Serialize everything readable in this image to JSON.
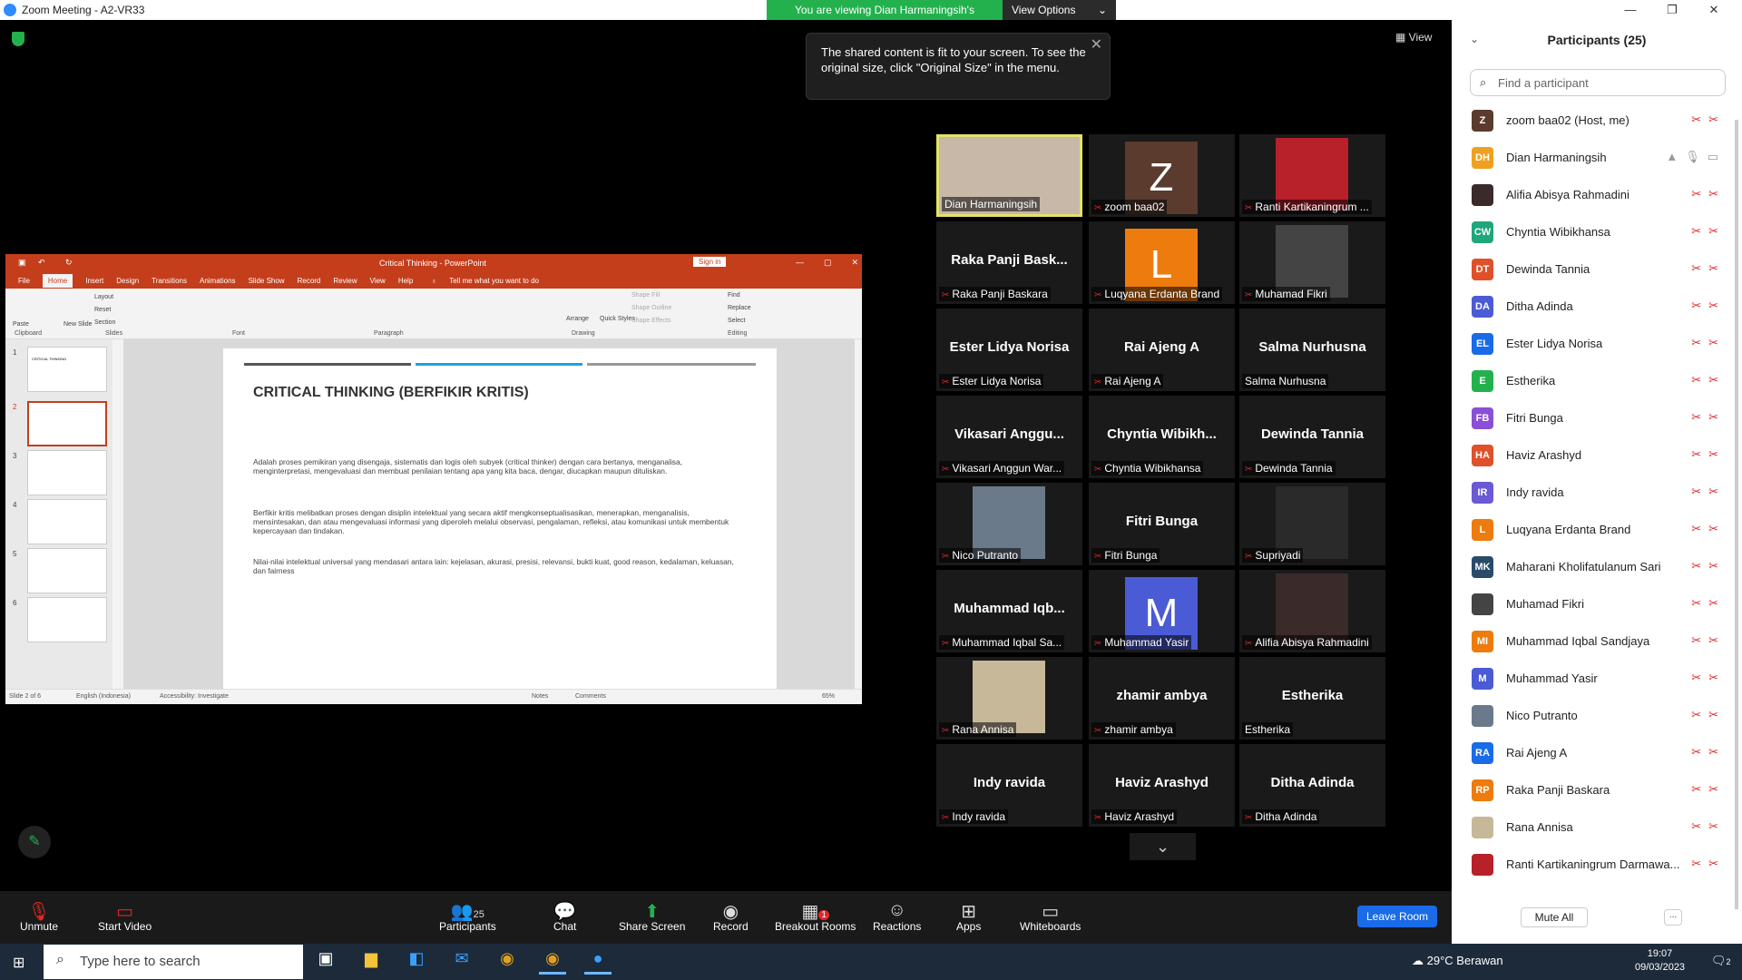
{
  "window": {
    "title": "Zoom Meeting - A2-VR33",
    "banner": "You are viewing Dian Harmaningsih's screen",
    "view_options": "View Options"
  },
  "stage": {
    "view_label": "View",
    "tooltip": "The shared content is fit to your screen. To see the original size, click \"Original Size\" in the menu."
  },
  "ppt": {
    "doc_title": "Critical Thinking  -  PowerPoint",
    "sign_in": "Sign in",
    "tabs": [
      "File",
      "Home",
      "Insert",
      "Design",
      "Transitions",
      "Animations",
      "Slide Show",
      "Record",
      "Review",
      "View",
      "Help"
    ],
    "tell_me": "Tell me what you want to do",
    "groups": {
      "clipboard": "Clipboard",
      "slides": "Slides",
      "font": "Font",
      "paragraph": "Paragraph",
      "drawing": "Drawing",
      "editing": "Editing"
    },
    "ribbon": {
      "paste": "Paste",
      "new_slide": "New Slide",
      "layout": "Layout",
      "reset": "Reset",
      "section": "Section",
      "arrange": "Arrange",
      "quick_styles": "Quick Styles",
      "shape_fill": "Shape Fill",
      "shape_outline": "Shape Outline",
      "shape_effects": "Shape Effects",
      "find": "Find",
      "replace": "Replace",
      "select": "Select"
    },
    "slide_title": "CRITICAL THINKING (BERFIKIR KRITIS)",
    "para1": "Adalah proses pemikiran yang disengaja, sistematis dan logis oleh subyek (critical thinker) dengan cara bertanya, menganalisa, menginterpretasi, mengevaluasi dan membuat penilaian tentang apa yang kita baca, dengar, diucapkan maupun dituliskan.",
    "para2": "Berfikir kritis melibatkan proses dengan disiplin intelektual yang secara aktif mengkonseptualisasikan, menerapkan, menganalisis, mensintesakan, dan atau mengevaluasi informasi yang diperoleh melalui observasi, pengalaman, refleksi, atau komunikasi untuk membentuk kepercayaan dan tindakan.",
    "para3": "Nilai-nilai intelektual universal yang mendasari antara lain: kejelasan, akurasi, presisi, relevansi, bukti kuat, good reason, kedalaman, keluasan, dan fairness",
    "slide_nums": [
      "1",
      "2",
      "3",
      "4",
      "5",
      "6"
    ],
    "thumb1_text": "CRITICAL THINKING",
    "status": {
      "slide": "Slide 2 of 6",
      "lang": "English (Indonesia)",
      "access": "Accessibility: Investigate",
      "notes": "Notes",
      "comments": "Comments",
      "zoom": "65%"
    }
  },
  "tiles": [
    {
      "big": "",
      "label": "Dian Harmaningsih",
      "kind": "photo",
      "color": "#c8b8a8",
      "mic": false
    },
    {
      "big": "",
      "label": "zoom baa02",
      "kind": "avatar",
      "letter": "Z",
      "color": "#5a3b2e",
      "mic": true
    },
    {
      "big": "",
      "label": "Ranti Kartikaningrum ...",
      "kind": "photo",
      "color": "#b8202a",
      "mic": true
    },
    {
      "big": "Raka Panji Bask...",
      "label": "Raka Panji Baskara",
      "kind": "name",
      "mic": true
    },
    {
      "big": "",
      "label": "Luqyana Erdanta Brand",
      "kind": "avatar",
      "letter": "L",
      "color": "#ee7b0e",
      "mic": true
    },
    {
      "big": "",
      "label": "Muhamad Fikri",
      "kind": "photo",
      "color": "#444444",
      "mic": true
    },
    {
      "big": "Ester Lidya Norisa",
      "label": "Ester Lidya Norisa",
      "kind": "name",
      "mic": true
    },
    {
      "big": "Rai Ajeng A",
      "label": "Rai Ajeng A",
      "kind": "name",
      "mic": true
    },
    {
      "big": "Salma Nurhusna",
      "label": "Salma Nurhusna",
      "kind": "name",
      "mic": false
    },
    {
      "big": "Vikasari Anggu...",
      "label": "Vikasari Anggun War...",
      "kind": "name",
      "mic": true
    },
    {
      "big": "Chyntia Wibikh...",
      "label": "Chyntia Wibikhansa",
      "kind": "name",
      "mic": true
    },
    {
      "big": "Dewinda Tannia",
      "label": "Dewinda Tannia",
      "kind": "name",
      "mic": true
    },
    {
      "big": "",
      "label": "Nico Putranto",
      "kind": "photo",
      "color": "#6a7a8a",
      "mic": true
    },
    {
      "big": "Fitri Bunga",
      "label": "Fitri Bunga",
      "kind": "name",
      "mic": true
    },
    {
      "big": "",
      "label": "Supriyadi",
      "kind": "photo",
      "color": "#2a2a2a",
      "mic": true
    },
    {
      "big": "Muhammad Iqb...",
      "label": "Muhammad Iqbal Sa...",
      "kind": "name",
      "mic": true
    },
    {
      "big": "",
      "label": "Muhammad Yasir",
      "kind": "avatar",
      "letter": "M",
      "color": "#4b5bd6",
      "mic": true
    },
    {
      "big": "",
      "label": "Alifia Abisya Rahmadini",
      "kind": "photo",
      "color": "#3a2a2a",
      "mic": true
    },
    {
      "big": "",
      "label": "Rana Annisa",
      "kind": "photo",
      "color": "#c8b89a",
      "mic": true
    },
    {
      "big": "zhamir ambya",
      "label": "zhamir ambya",
      "kind": "name",
      "mic": true
    },
    {
      "big": "Estherika",
      "label": "Estherika",
      "kind": "name",
      "mic": false
    },
    {
      "big": "Indy ravida",
      "label": "Indy ravida",
      "kind": "name",
      "mic": true
    },
    {
      "big": "Haviz Arashyd",
      "label": "Haviz Arashyd",
      "kind": "name",
      "mic": true
    },
    {
      "big": "Ditha Adinda",
      "label": "Ditha Adinda",
      "kind": "name",
      "mic": true
    }
  ],
  "panel": {
    "title": "Participants (25)",
    "search_placeholder": "Find a participant",
    "participants": [
      {
        "initials": "Z",
        "name": "zoom baa02 (Host, me)",
        "color": "#5a3b2e"
      },
      {
        "initials": "DH",
        "name": "Dian Harmaningsih",
        "color": "#f0a020"
      },
      {
        "initials": "",
        "name": "Alifia Abisya Rahmadini",
        "color": "#3a2a2a"
      },
      {
        "initials": "CW",
        "name": "Chyntia Wibikhansa",
        "color": "#1fa67a"
      },
      {
        "initials": "DT",
        "name": "Dewinda Tannia",
        "color": "#e0502a"
      },
      {
        "initials": "DA",
        "name": "Ditha Adinda",
        "color": "#4b5bd6"
      },
      {
        "initials": "EL",
        "name": "Ester Lidya Norisa",
        "color": "#1a6be8"
      },
      {
        "initials": "E",
        "name": "Estherika",
        "color": "#23b14d"
      },
      {
        "initials": "FB",
        "name": "Fitri Bunga",
        "color": "#8b4fd6"
      },
      {
        "initials": "HA",
        "name": "Haviz Arashyd",
        "color": "#e0502a"
      },
      {
        "initials": "IR",
        "name": "Indy ravida",
        "color": "#6a5ad6"
      },
      {
        "initials": "L",
        "name": "Luqyana Erdanta Brand",
        "color": "#ee7b0e"
      },
      {
        "initials": "MK",
        "name": "Maharani Kholifatulanum Sari",
        "color": "#2a4a6a"
      },
      {
        "initials": "",
        "name": "Muhamad Fikri",
        "color": "#444444"
      },
      {
        "initials": "MI",
        "name": "Muhammad Iqbal Sandjaya",
        "color": "#ee7b0e"
      },
      {
        "initials": "M",
        "name": "Muhammad Yasir",
        "color": "#4b5bd6"
      },
      {
        "initials": "",
        "name": "Nico Putranto",
        "color": "#6a7a8a"
      },
      {
        "initials": "RA",
        "name": "Rai Ajeng A",
        "color": "#1a6be8"
      },
      {
        "initials": "RP",
        "name": "Raka Panji Baskara",
        "color": "#ee7b0e"
      },
      {
        "initials": "",
        "name": "Rana Annisa",
        "color": "#c8b89a"
      },
      {
        "initials": "",
        "name": "Ranti Kartikaningrum Darmawa...",
        "color": "#b8202a"
      }
    ],
    "mute_all": "Mute All",
    "more": "..."
  },
  "toolbar": {
    "unmute": "Unmute",
    "start_video": "Start Video",
    "participants": "Participants",
    "participants_count": "25",
    "chat": "Chat",
    "share": "Share Screen",
    "record": "Record",
    "breakout": "Breakout Rooms",
    "breakout_badge": "1",
    "reactions": "Reactions",
    "apps": "Apps",
    "whiteboards": "Whiteboards",
    "leave": "Leave Room"
  },
  "taskbar": {
    "search": "Type here to search",
    "weather": "29°C  Berawan",
    "time": "19:07",
    "date": "09/03/2023",
    "notif": "2"
  }
}
